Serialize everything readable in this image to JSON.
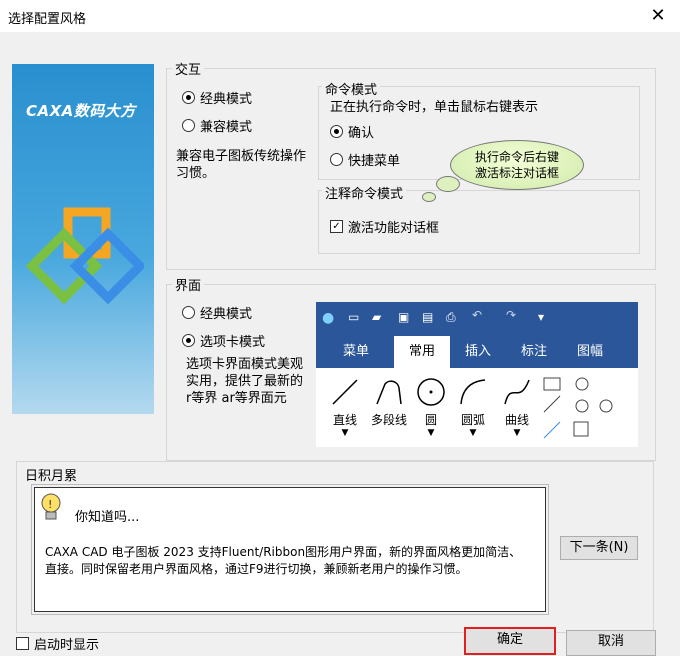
{
  "dialog": {
    "title": "选择配置风格"
  },
  "banner": {
    "brand": "CAXA数码大方"
  },
  "interaction": {
    "label": "交互",
    "options": [
      {
        "label": "经典模式",
        "selected": true
      },
      {
        "label": "兼容模式",
        "selected": false
      }
    ],
    "description": "兼容电子图板传统操作习惯。"
  },
  "command_mode": {
    "label": "命令模式",
    "hint": "正在执行命令时，单击鼠标右键表示",
    "options": [
      {
        "label": "确认",
        "selected": true
      },
      {
        "label": "快捷菜单",
        "selected": false
      }
    ]
  },
  "annotation_mode": {
    "label": "注释命令模式",
    "checkbox_label": "激活功能对话框",
    "checked": true
  },
  "bubble": {
    "line1": "执行命令后右键",
    "line2": "激活标注对话框"
  },
  "interface": {
    "label": "界面",
    "options": [
      {
        "label": "经典模式",
        "selected": false
      },
      {
        "label": "选项卡模式",
        "selected": true
      }
    ],
    "description_line1": "选项卡界面模式美观",
    "description_line2": "实用，提供了最新的",
    "description_line3": "r等界 ar等界面元"
  },
  "ribbon_preview": {
    "tabs": [
      "菜单",
      "常用",
      "插入",
      "标注",
      "图幅"
    ],
    "active_tab": "常用",
    "tools": [
      "直线",
      "多段线",
      "圆",
      "圆弧",
      "曲线"
    ]
  },
  "tips": {
    "label": "日积月累",
    "heading": "你知道吗...",
    "body_line1": "CAXA CAD 电子图板 2023 支持Fluent/Ribbon图形用户界面，新的界面风格更加简洁、",
    "body_line2": "直接。同时保留老用户界面风格，通过F9进行切换，兼顾新老用户的操作习惯。",
    "next_button": "下一条(N)"
  },
  "footer": {
    "startup_checkbox": "启动时显示",
    "ok_button": "确定",
    "cancel_button": "取消"
  },
  "colors": {
    "ribbon_blue": "#2b579a",
    "ok_highlight": "#e02020",
    "bubble_fill": "#d8efb2"
  }
}
